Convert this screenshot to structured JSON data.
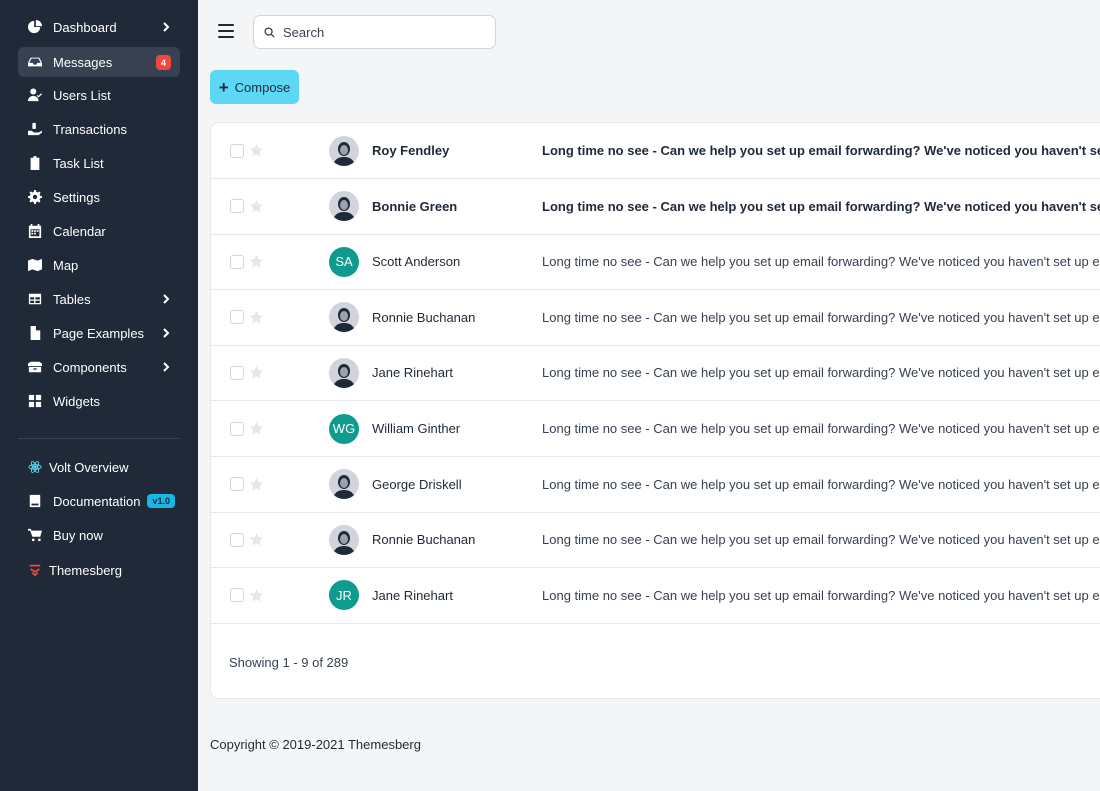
{
  "sidebar": {
    "items": [
      {
        "label": "Dashboard",
        "icon": "pie-chart-icon",
        "chevron": true
      },
      {
        "label": "Messages",
        "icon": "inbox-icon",
        "badge": "4",
        "active": true
      },
      {
        "label": "Users List",
        "icon": "user-check-icon"
      },
      {
        "label": "Transactions",
        "icon": "cash-hand-icon"
      },
      {
        "label": "Task List",
        "icon": "clipboard-icon"
      },
      {
        "label": "Settings",
        "icon": "gear-icon"
      },
      {
        "label": "Calendar",
        "icon": "calendar-icon"
      },
      {
        "label": "Map",
        "icon": "map-icon"
      },
      {
        "label": "Tables",
        "icon": "table-icon",
        "chevron": true
      },
      {
        "label": "Page Examples",
        "icon": "document-icon",
        "chevron": true
      },
      {
        "label": "Components",
        "icon": "archive-icon",
        "chevron": true
      },
      {
        "label": "Widgets",
        "icon": "widgets-icon"
      }
    ],
    "secondary": [
      {
        "label": "Volt Overview",
        "icon": "react-icon"
      },
      {
        "label": "Documentation",
        "icon": "book-icon",
        "badge": "v1.0"
      },
      {
        "label": "Buy now",
        "icon": "cart-icon"
      },
      {
        "label": "Themesberg",
        "icon": "themesberg-logo-icon"
      }
    ]
  },
  "topbar": {
    "search_placeholder": "Search"
  },
  "compose_label": "Compose",
  "messages": [
    {
      "sender": "Roy Fendley",
      "avatar": "photo",
      "text": "Long time no see - Can we help you set up email forwarding? We've noticed you haven't set up email forwarding",
      "unread": true
    },
    {
      "sender": "Bonnie Green",
      "avatar": "photo",
      "text": "Long time no see - Can we help you set up email forwarding? We've noticed you haven't set up email forwarding",
      "unread": true
    },
    {
      "sender": "Scott Anderson",
      "avatar": "initials",
      "initials": "SA",
      "text": "Long time no see - Can we help you set up email forwarding? We've noticed you haven't set up email forwarding",
      "unread": false
    },
    {
      "sender": "Ronnie Buchanan",
      "avatar": "photo",
      "text": "Long time no see - Can we help you set up email forwarding? We've noticed you haven't set up email forwarding",
      "unread": false
    },
    {
      "sender": "Jane Rinehart",
      "avatar": "photo",
      "text": "Long time no see - Can we help you set up email forwarding? We've noticed you haven't set up email forwarding",
      "unread": false
    },
    {
      "sender": "William Ginther",
      "avatar": "initials",
      "initials": "WG",
      "text": "Long time no see - Can we help you set up email forwarding? We've noticed you haven't set up email forwarding",
      "unread": false
    },
    {
      "sender": "George Driskell",
      "avatar": "photo",
      "text": "Long time no see - Can we help you set up email forwarding? We've noticed you haven't set up email forwarding",
      "unread": false
    },
    {
      "sender": "Ronnie Buchanan",
      "avatar": "photo",
      "text": "Long time no see - Can we help you set up email forwarding? We've noticed you haven't set up email forwarding",
      "unread": false
    },
    {
      "sender": "Jane Rinehart",
      "avatar": "initials",
      "initials": "JR",
      "text": "Long time no see - Can we help you set up email forwarding? We've noticed you haven't set up email forwarding",
      "unread": false
    }
  ],
  "pagination_text": "Showing 1 - 9 of 289",
  "footer_text": "Copyright © 2019-2021 Themesberg",
  "colors": {
    "sidebar_bg": "#1f2937",
    "accent": "#5cd7f5",
    "initials_avatar": "#0f9b8e",
    "badge_red": "#f0483e",
    "badge_blue": "#19b7e6"
  }
}
